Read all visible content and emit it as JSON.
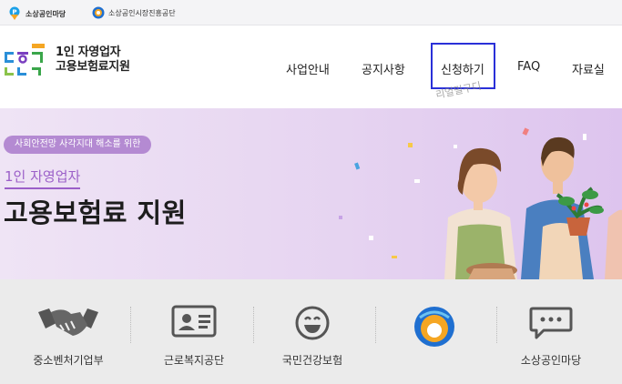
{
  "topbar": {
    "link1_label": "소상공인마당",
    "link1_icon": "p-marker-icon",
    "link2_label": "소상공인시장진흥공단",
    "link2_icon": "agency-logo-icon"
  },
  "header": {
    "logo_line1": "1인 자영업자",
    "logo_line2": "고용보험료지원",
    "nav": [
      "사업안내",
      "공지사항",
      "신청하기",
      "FAQ",
      "자료실"
    ],
    "watermark": "리얼밀구디"
  },
  "hero": {
    "pill": "사회안전망 사각지대 해소를 위한",
    "subtitle": "1인 자영업자",
    "title": "고용보험료 지원"
  },
  "quick_links": [
    {
      "label": "중소벤처기업부",
      "icon": "handshake-icon"
    },
    {
      "label": "근로복지공단",
      "icon": "id-card-icon"
    },
    {
      "label": "국민건강보험",
      "icon": "smile-icon"
    },
    {
      "label": "",
      "icon": "agency-logo-icon"
    },
    {
      "label": "소상공인마당",
      "icon": "chat-bubble-icon"
    }
  ],
  "colors": {
    "accent": "#9b5fc8",
    "pill_bg": "#b48ad2",
    "highlight_box": "#2a30d8",
    "hero_bg": "#e6d4f1"
  }
}
